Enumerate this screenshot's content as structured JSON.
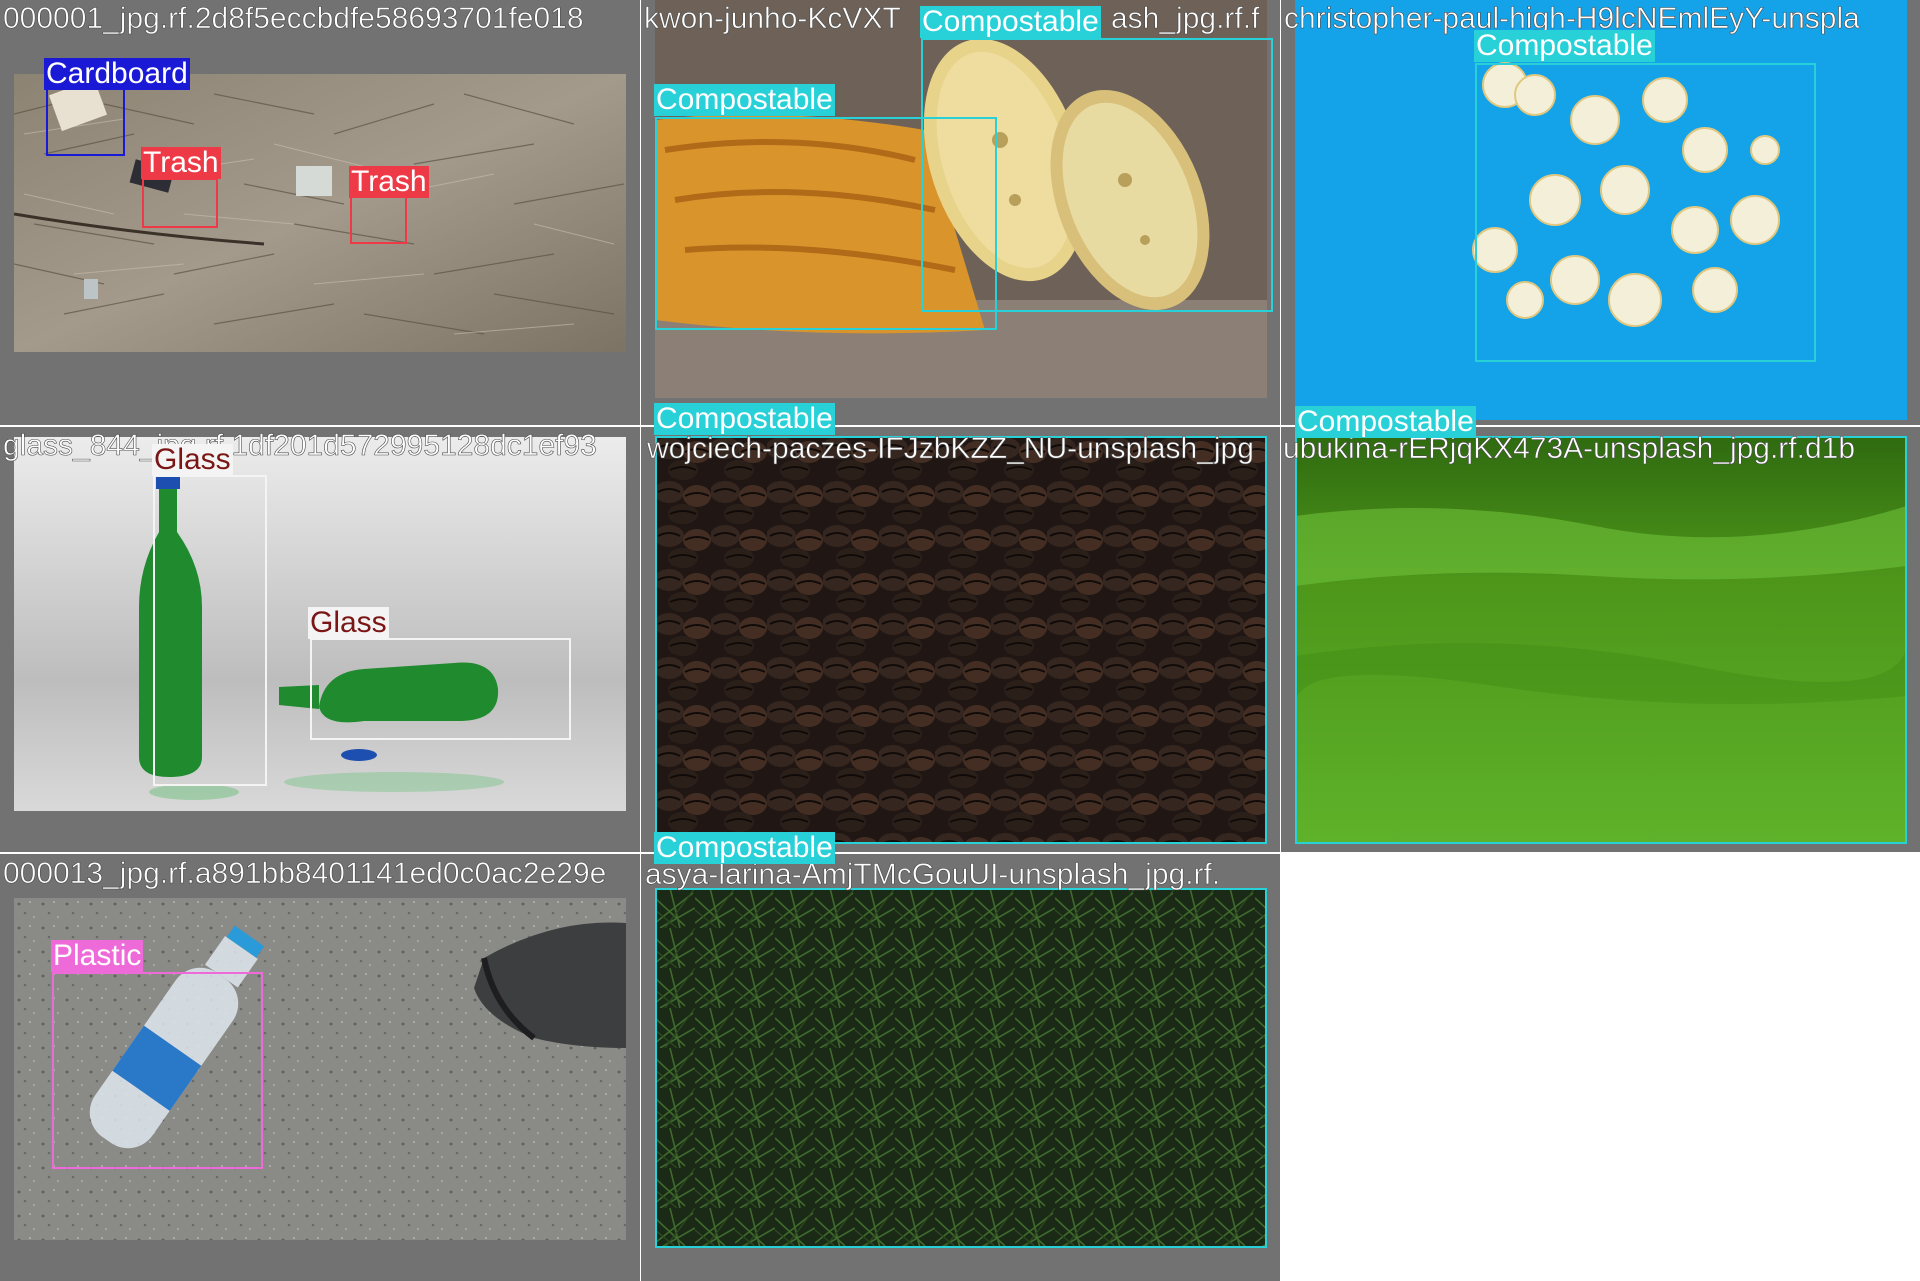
{
  "colors": {
    "cardboard": "#1a1ad6",
    "trash": "#ee3a46",
    "compostable": "#28d0d8",
    "glass": "#f4f4f4",
    "glass_text": "#7a1616",
    "plastic": "#ee6ad8",
    "tile_bg": "#727272"
  },
  "tiles": [
    {
      "filename": "000001_jpg.rf.2d8f5eccbdfe58693701fe018",
      "labels": [
        "Cardboard",
        "Trash",
        "Trash"
      ]
    },
    {
      "filename": "kwon-junho-KcVXT",
      "filename_tail": "ash_jpg.rf.f",
      "labels": [
        "Compostable",
        "Compostable"
      ]
    },
    {
      "filename": "christopher-paul-high-H9lcNEmlEyY-unspla",
      "labels": [
        "Compostable"
      ]
    },
    {
      "filename": "glass_844_jpg.rf.1df201d572995128dc1ef93",
      "labels": [
        "Glass",
        "Glass"
      ]
    },
    {
      "filename": "wojciech-paczes-IFJzbKZZ_NU-unsplash_jpg",
      "labels": [
        "Compostable"
      ]
    },
    {
      "filename": "ubukina-rERjqKX473A-unsplash_jpg.rf.d1b",
      "labels": [
        "Compostable"
      ]
    },
    {
      "filename": "000013_jpg.rf.a891bb8401141ed0c0ac2e29e",
      "labels": [
        "Plastic"
      ]
    },
    {
      "filename": "asya-larina-AmjTMcGouUI-unsplash_jpg.rf.",
      "labels": [
        "Compostable"
      ]
    }
  ]
}
